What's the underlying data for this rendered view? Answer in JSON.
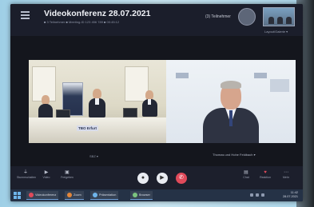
{
  "meeting": {
    "title": "Videokonferenz 28.07.2021",
    "info": "■ 3 Teilnehmer ■ Meeting-ID 123 456 789 ■ 00:45:12",
    "participants": "(3) Teilnehmer",
    "layout": "Layout/Galerie ▾"
  },
  "tiles": {
    "room_tag": "TBO Erfurt",
    "room_caption": "SBZ ▾",
    "speaker_caption": "Thomas und Hohe Feldbach ▾"
  },
  "controls": [
    {
      "icon": "mic-icon",
      "glyph": "⏚",
      "label": "Stummschalten"
    },
    {
      "icon": "video-icon",
      "glyph": "▶",
      "label": "Video"
    },
    {
      "icon": "share-icon",
      "glyph": "▣",
      "label": "Freigeben"
    }
  ],
  "right_controls": [
    {
      "icon": "chat-icon",
      "glyph": "▤",
      "label": "Chat"
    },
    {
      "icon": "reactions-icon",
      "glyph": "♥",
      "label": "Reaktion"
    },
    {
      "icon": "more-icon",
      "glyph": "⋯",
      "label": "Mehr"
    }
  ],
  "taskbar": {
    "apps": [
      "Videokonferenz",
      "Zoom",
      "Präsentation",
      "Browser"
    ],
    "time": "11:42",
    "date": "28.07.2021"
  },
  "colors": {
    "end_call": "#e04a5a",
    "mic_button": "#ffffff",
    "accent": "#6fb4ea"
  }
}
